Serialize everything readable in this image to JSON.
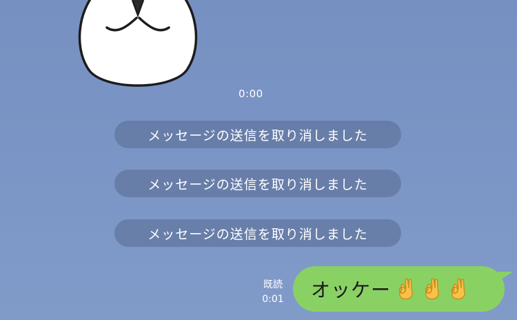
{
  "sticker": {
    "icon": "bow-character-sticker"
  },
  "sticker_time": "0:00",
  "notices": [
    {
      "text": "メッセージの送信を取り消しました"
    },
    {
      "text": "メッセージの送信を取り消しました"
    },
    {
      "text": "メッセージの送信を取り消しました"
    }
  ],
  "outgoing": {
    "read_label": "既読",
    "time": "0:01",
    "text": "オッケー",
    "emojis": [
      "ok-hand-icon",
      "ok-hand-icon",
      "ok-hand-icon"
    ],
    "bubble_color": "#8ad164"
  },
  "colors": {
    "background": "#7a95c4",
    "notice_bg": "#5c7098"
  }
}
